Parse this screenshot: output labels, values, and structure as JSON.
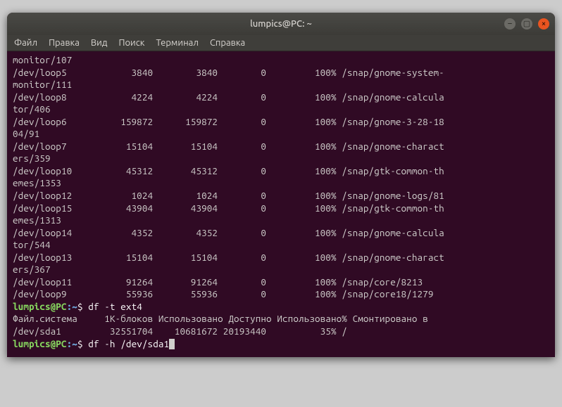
{
  "titlebar": {
    "title": "lumpics@PC: ~"
  },
  "menubar": [
    "Файл",
    "Правка",
    "Вид",
    "Поиск",
    "Терминал",
    "Справка"
  ],
  "icons": {
    "min": "–",
    "max": "▢",
    "close": "×"
  },
  "header_row": {
    "fs": "Файл.система",
    "blocks": "1K-блоков",
    "used": "Использовано",
    "avail": "Доступно",
    "usepct": "Использовано%",
    "mount": "Смонтировано в"
  },
  "rows": [
    {
      "fs": "monitor/107",
      "blocks": "",
      "used": "",
      "avail": "",
      "usepct": "",
      "mount": ""
    },
    {
      "fs": "/dev/loop5",
      "blocks": "3840",
      "used": "3840",
      "avail": "0",
      "usepct": "100%",
      "mount": "/snap/gnome-system-"
    },
    {
      "fs": "monitor/111",
      "blocks": "",
      "used": "",
      "avail": "",
      "usepct": "",
      "mount": ""
    },
    {
      "fs": "/dev/loop8",
      "blocks": "4224",
      "used": "4224",
      "avail": "0",
      "usepct": "100%",
      "mount": "/snap/gnome-calcula"
    },
    {
      "fs": "tor/406",
      "blocks": "",
      "used": "",
      "avail": "",
      "usepct": "",
      "mount": ""
    },
    {
      "fs": "/dev/loop6",
      "blocks": "159872",
      "used": "159872",
      "avail": "0",
      "usepct": "100%",
      "mount": "/snap/gnome-3-28-18"
    },
    {
      "fs": "04/91",
      "blocks": "",
      "used": "",
      "avail": "",
      "usepct": "",
      "mount": ""
    },
    {
      "fs": "/dev/loop7",
      "blocks": "15104",
      "used": "15104",
      "avail": "0",
      "usepct": "100%",
      "mount": "/snap/gnome-charact"
    },
    {
      "fs": "ers/359",
      "blocks": "",
      "used": "",
      "avail": "",
      "usepct": "",
      "mount": ""
    },
    {
      "fs": "/dev/loop10",
      "blocks": "45312",
      "used": "45312",
      "avail": "0",
      "usepct": "100%",
      "mount": "/snap/gtk-common-th"
    },
    {
      "fs": "emes/1353",
      "blocks": "",
      "used": "",
      "avail": "",
      "usepct": "",
      "mount": ""
    },
    {
      "fs": "/dev/loop12",
      "blocks": "1024",
      "used": "1024",
      "avail": "0",
      "usepct": "100%",
      "mount": "/snap/gnome-logs/81"
    },
    {
      "fs": "/dev/loop15",
      "blocks": "43904",
      "used": "43904",
      "avail": "0",
      "usepct": "100%",
      "mount": "/snap/gtk-common-th"
    },
    {
      "fs": "emes/1313",
      "blocks": "",
      "used": "",
      "avail": "",
      "usepct": "",
      "mount": ""
    },
    {
      "fs": "/dev/loop14",
      "blocks": "4352",
      "used": "4352",
      "avail": "0",
      "usepct": "100%",
      "mount": "/snap/gnome-calcula"
    },
    {
      "fs": "tor/544",
      "blocks": "",
      "used": "",
      "avail": "",
      "usepct": "",
      "mount": ""
    },
    {
      "fs": "/dev/loop13",
      "blocks": "15104",
      "used": "15104",
      "avail": "0",
      "usepct": "100%",
      "mount": "/snap/gnome-charact"
    },
    {
      "fs": "ers/367",
      "blocks": "",
      "used": "",
      "avail": "",
      "usepct": "",
      "mount": ""
    },
    {
      "fs": "/dev/loop11",
      "blocks": "91264",
      "used": "91264",
      "avail": "0",
      "usepct": "100%",
      "mount": "/snap/core/8213"
    },
    {
      "fs": "/dev/loop9",
      "blocks": "55936",
      "used": "55936",
      "avail": "0",
      "usepct": "100%",
      "mount": "/snap/core18/1279"
    }
  ],
  "prompt1": {
    "user": "lumpics@PC",
    "path": "~",
    "sep1": ":",
    "dollar": "$",
    "cmd": "df -t ext4"
  },
  "ext4_row": {
    "fs": "/dev/sda1",
    "blocks": "32551704",
    "used": "10681672",
    "avail": "20193440",
    "usepct": "35%",
    "mount": "/"
  },
  "prompt2": {
    "user": "lumpics@PC",
    "path": "~",
    "sep1": ":",
    "dollar": "$",
    "cmd": "df -h /dev/sda1"
  }
}
